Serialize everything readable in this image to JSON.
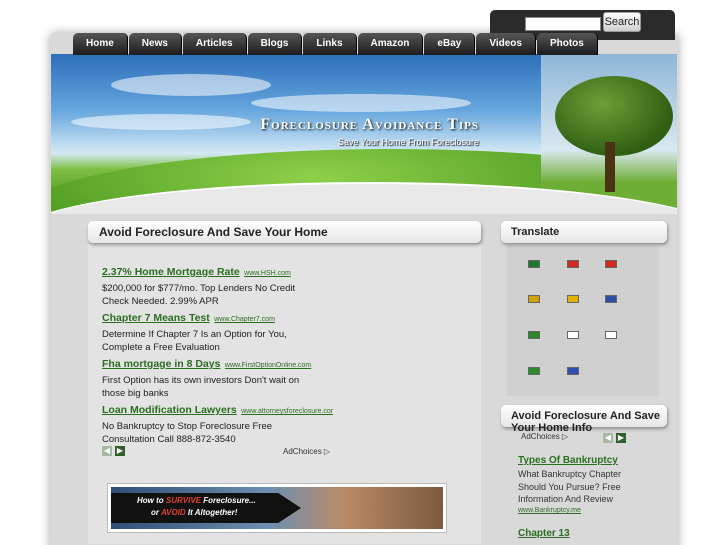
{
  "search": {
    "button_label": "Search",
    "placeholder": ""
  },
  "nav": {
    "items": [
      "Home",
      "News",
      "Articles",
      "Blogs",
      "Links",
      "Amazon",
      "eBay",
      "Videos",
      "Photos"
    ]
  },
  "site": {
    "title": "Foreclosure Avoidance Tips",
    "subtitle": "Save Your Home From Foreclosure"
  },
  "main": {
    "title": "Avoid Foreclosure And Save Your Home",
    "ads": [
      {
        "headline": "2.37% Home Mortgage Rate",
        "url": "www.HSH.com",
        "desc1": "$200,000 for $777/mo. Top Lenders No Credit",
        "desc2": "Check Needed. 2.99% APR"
      },
      {
        "headline": "Chapter 7 Means Test",
        "url": "www.Chapter7.com",
        "desc1": "Determine If Chapter 7 Is an Option for You,",
        "desc2": "Complete a Free Evaluation"
      },
      {
        "headline": "Fha mortgage in 8 Days",
        "url": "www.FirstOptionOnline.com",
        "desc1": "First Option has its own investors Don't wait on",
        "desc2": "those big banks"
      },
      {
        "headline": "Loan Modification Lawyers",
        "url": "www.attorneysforeclosure.cor",
        "desc1": "No Bankruptcy to Stop Foreclosure Free",
        "desc2": "Consultation Call 888-872-3540"
      }
    ],
    "adchoices": "AdChoices",
    "banner": {
      "line1_a": "How to ",
      "line1_b": "SURVIVE",
      "line1_c": " Foreclosure...",
      "line2_a": "or ",
      "line2_b": "AVOID",
      "line2_c": " It Altogether!"
    }
  },
  "sidebar": {
    "translate_title": "Translate",
    "flags": [
      {
        "name": "arabic-flag",
        "color": "#1a7a2a"
      },
      {
        "name": "chinese-simplified-flag",
        "color": "#d02a1c"
      },
      {
        "name": "chinese-traditional-flag",
        "color": "#d02a1c"
      },
      {
        "name": "german-flag",
        "color": "#d4a00a"
      },
      {
        "name": "spanish-flag",
        "color": "#e0b000"
      },
      {
        "name": "french-flag",
        "color": "#2f4da0"
      },
      {
        "name": "italian-flag",
        "color": "#2a8a2a"
      },
      {
        "name": "japanese-flag",
        "color": "#ffffff"
      },
      {
        "name": "korean-flag",
        "color": "#ffffff"
      },
      {
        "name": "portuguese-flag",
        "color": "#2a8a2a"
      },
      {
        "name": "russian-flag",
        "color": "#3050b0"
      }
    ],
    "avoid_title": "Avoid Foreclosure And Save Your Home Info",
    "adchoices": "AdChoices",
    "ad1": {
      "headline": "Types Of Bankruptcy",
      "desc1": "What Bankruptcy Chapter",
      "desc2": "Should You Pursue? Free",
      "desc3": "Information And Review",
      "url": "www.Bankruptcy.me"
    },
    "ad2": {
      "headline": "Chapter 13"
    }
  }
}
